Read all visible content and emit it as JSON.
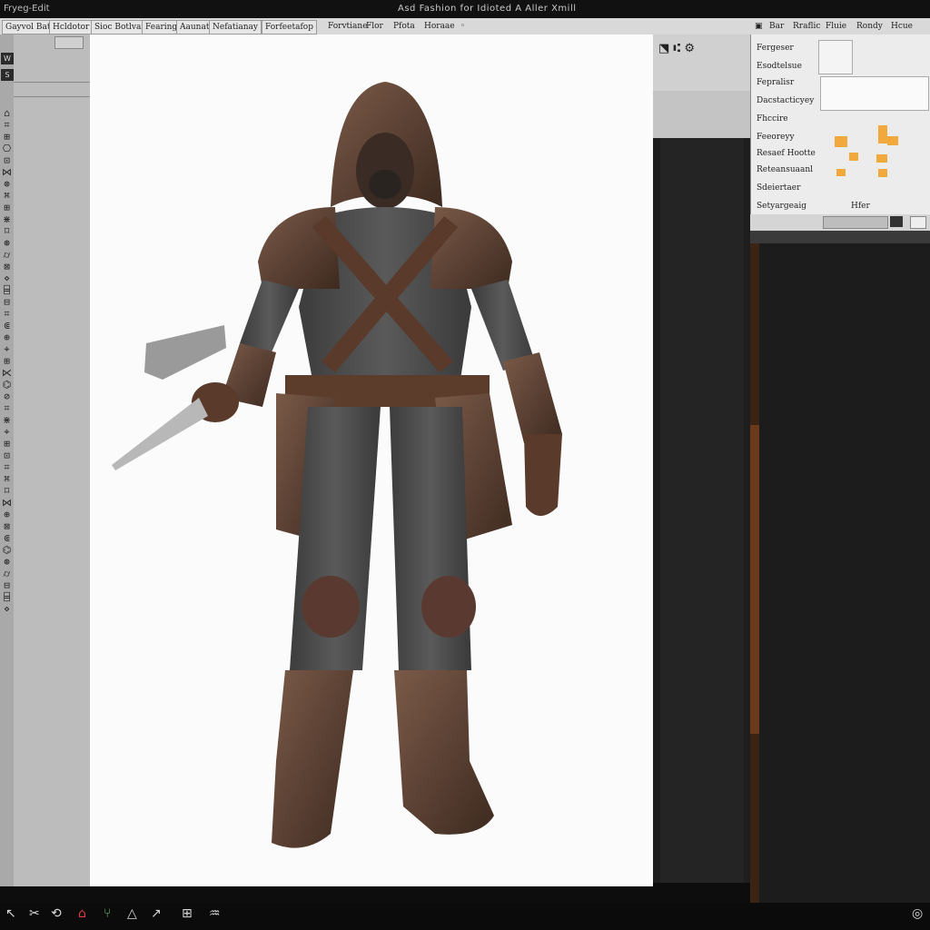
{
  "window": {
    "left_text": "Fryeg-Edit",
    "center_title": "Asd Fashion for Idioted A Aller Xmill"
  },
  "menubar": {
    "items": [
      "Gayvol Batdvar",
      "Hcldotor",
      "Sioc Botlvar",
      "Fearing",
      "Aaunat",
      "Nefatianay",
      "Forfeetafop",
      "Forvtiane",
      "Flor",
      "Pfota",
      "Horaae",
      "◦"
    ]
  },
  "right_top": {
    "items": [
      "▣",
      "Bar",
      "Rraflic",
      "Fluie",
      "Rondy",
      "Hcue"
    ]
  },
  "right_panel": {
    "rows": [
      {
        "label": "Fergeser"
      },
      {
        "label": "Esodtelsue"
      },
      {
        "label": "Fepralisr"
      },
      {
        "label": "Dacstacticyey"
      },
      {
        "label": "Fhccire"
      },
      {
        "label": "Feeoreyy"
      },
      {
        "label": "Resaef Hootte"
      },
      {
        "label": "Reteansuaanl"
      },
      {
        "label": "Sdeiertaer"
      },
      {
        "label": "Setyargeaig"
      }
    ],
    "toolbar_label": "Hfer"
  },
  "left_panel": {
    "badges": [
      "W",
      "S"
    ],
    "glyphs": [
      "⌂",
      "⌗",
      "⊞",
      "⎔",
      "⊡",
      "⋈",
      "⊗",
      "⌘",
      "⊞",
      "⋇",
      "⌑",
      "⊛",
      "⌭",
      "⊠",
      "⋄",
      "⌸",
      "⊟",
      "⌗",
      "⋐",
      "⊕",
      "⌖",
      "⊞",
      "⋉",
      "⌬",
      "⊘",
      "⌗",
      "⋇",
      "⌖",
      "⊞",
      "⊡",
      "⌗",
      "⌘",
      "⌑",
      "⋈",
      "⊕",
      "⊠",
      "⋐",
      "⌬",
      "⊛",
      "⌭",
      "⊟",
      "⌸",
      "⋄"
    ]
  },
  "bottombar": {
    "icons": [
      "arrow-cursor",
      "scissors",
      "rotate",
      "home",
      "fork",
      "triangle",
      "pointer",
      "grid",
      "script"
    ],
    "right_label": "◎"
  },
  "colors": {
    "accent_orange": "#f2a93b",
    "canvas_bg": "#fbfbfb",
    "panel_grey": "#bcbcbc",
    "dark": "#1e1e1e"
  }
}
